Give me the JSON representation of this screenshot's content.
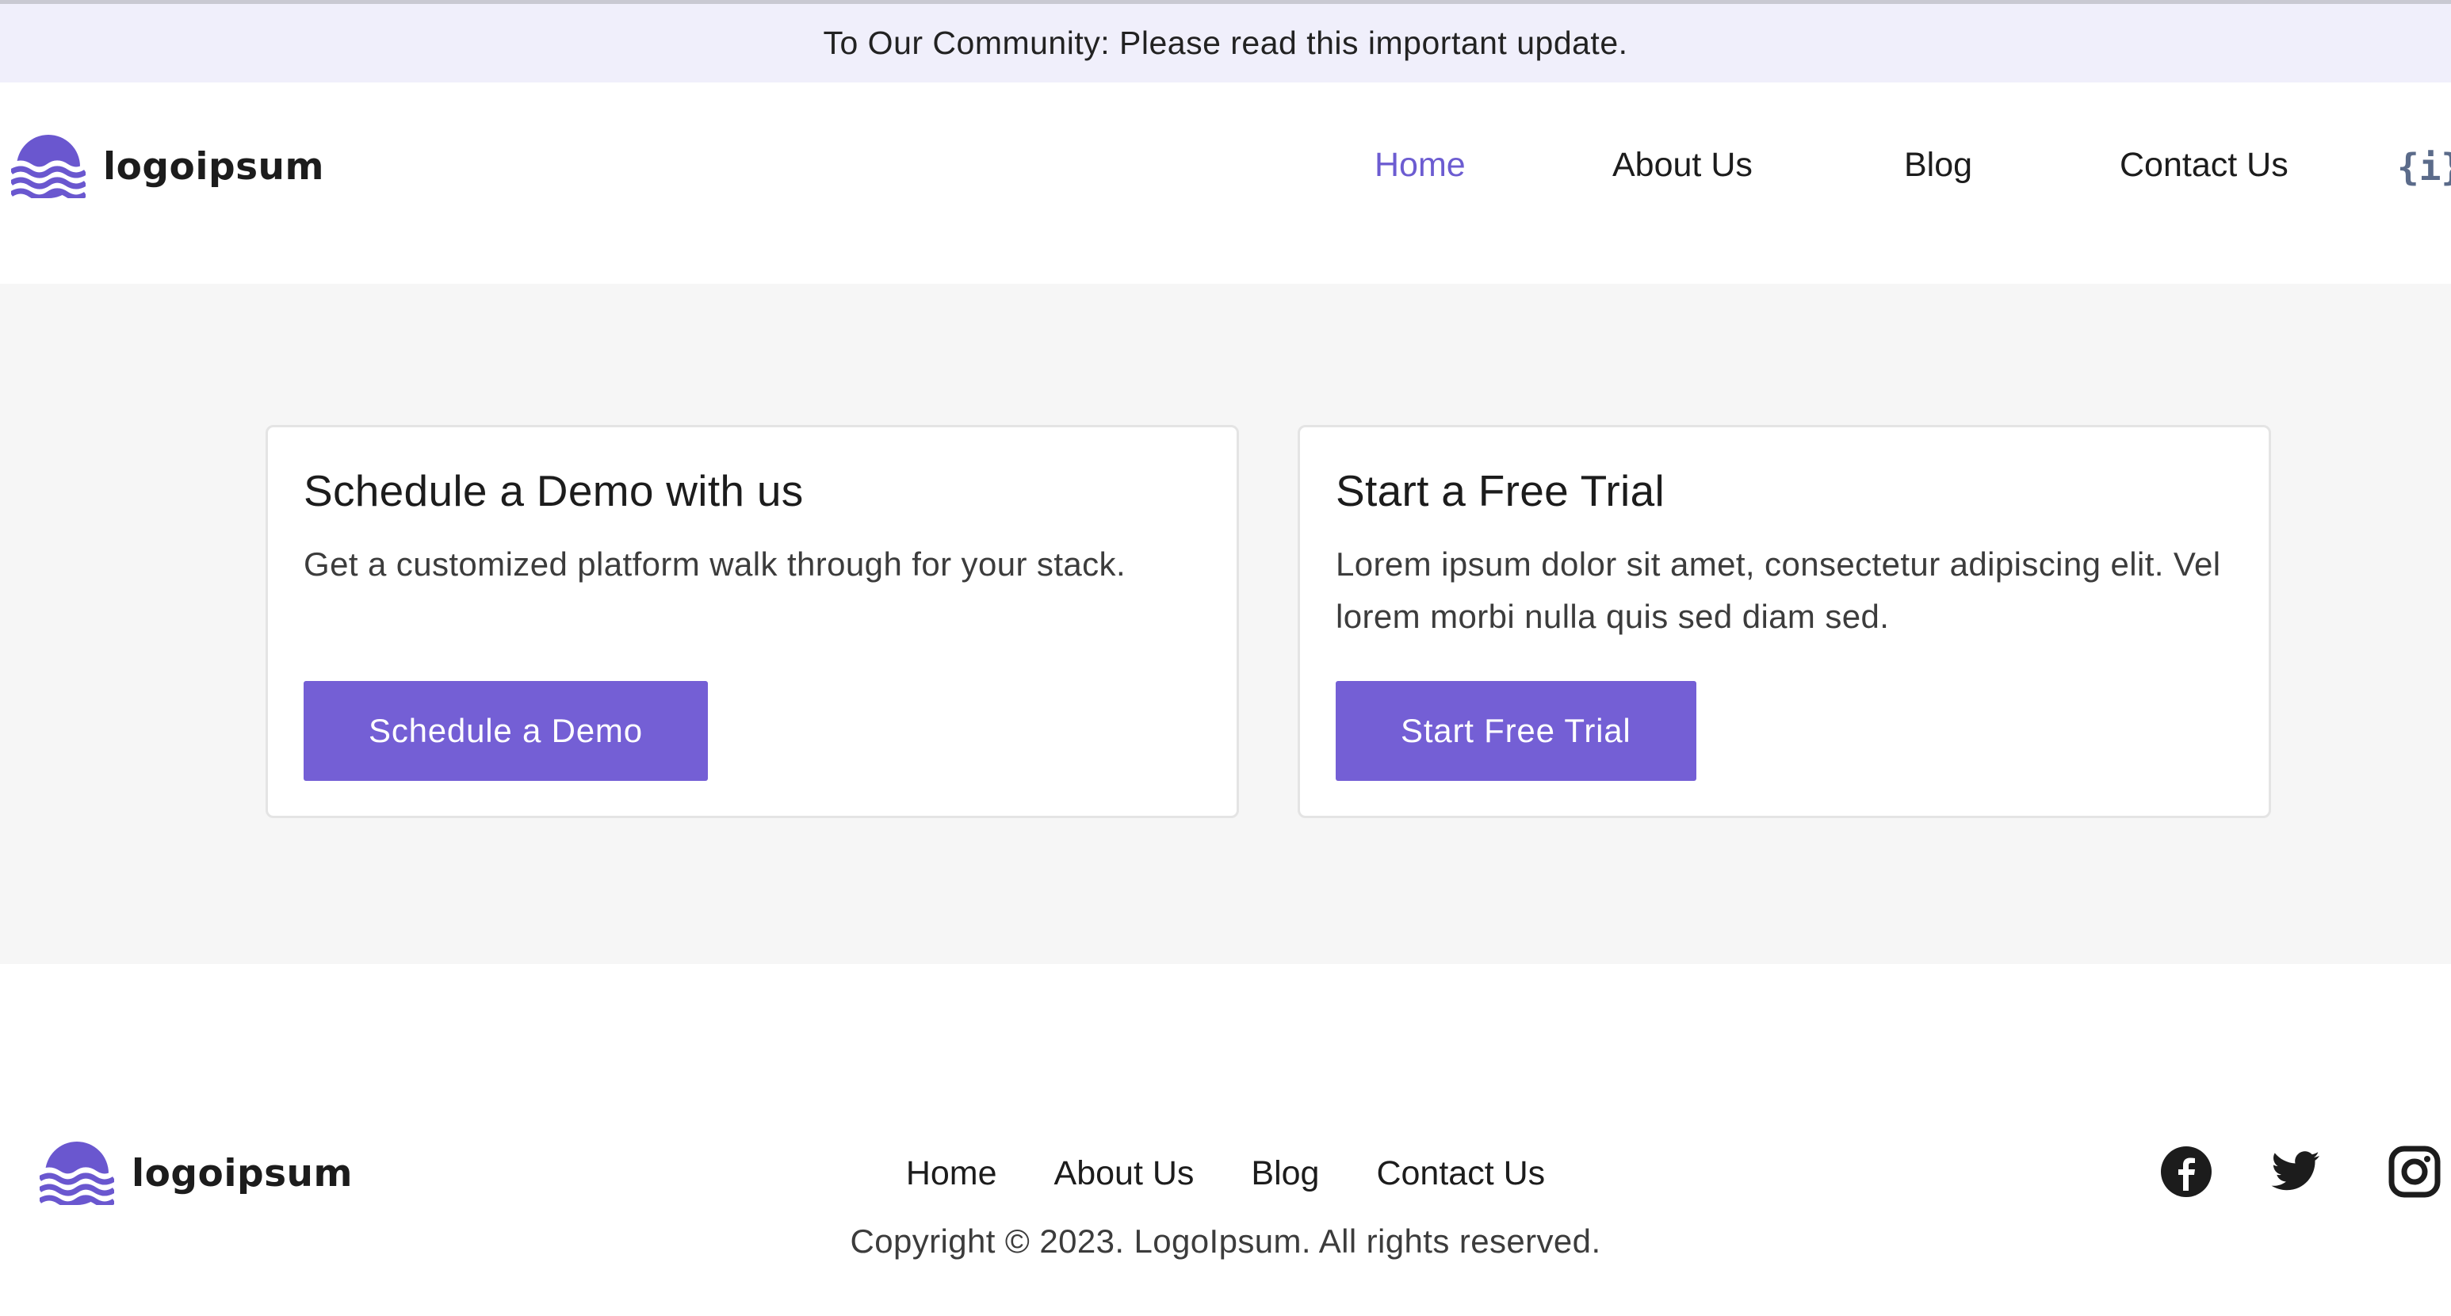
{
  "announcement": {
    "text": "To Our Community: Please read this important update."
  },
  "brand": {
    "name": "logoipsum",
    "accent": "#745fd5",
    "logo_icon": "wave-sun-logo-icon"
  },
  "header": {
    "nav": [
      {
        "label": "Home",
        "active": true
      },
      {
        "label": "About Us",
        "active": false
      },
      {
        "label": "Blog",
        "active": false
      },
      {
        "label": "Contact Us",
        "active": false
      }
    ],
    "code_icon": {
      "glyph": "{i}",
      "icon": "code-braces-icon"
    }
  },
  "cards": [
    {
      "title": "Schedule a Demo with us",
      "body": "Get a customized platform walk through for your stack.",
      "button": "Schedule a Demo"
    },
    {
      "title": "Start a Free Trial",
      "body": "Lorem ipsum dolor sit amet, consectetur adipiscing elit. Vel lorem morbi nulla quis sed diam sed.",
      "button": "Start Free Trial"
    }
  ],
  "footer": {
    "nav": [
      {
        "label": "Home"
      },
      {
        "label": "About Us"
      },
      {
        "label": "Blog"
      },
      {
        "label": "Contact Us"
      }
    ],
    "copyright": "Copyright © 2023. LogoIpsum. All rights reserved.",
    "social": [
      "facebook-icon",
      "twitter-icon",
      "instagram-icon"
    ]
  },
  "colors": {
    "announcement_bg": "#f0effb",
    "hero_bg": "#f6f6f6",
    "nav_active": "#6c5cd1",
    "button_bg": "#745fd5",
    "button_text": "#ffffff"
  }
}
